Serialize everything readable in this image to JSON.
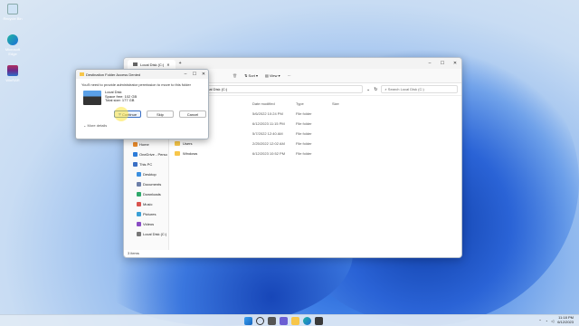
{
  "desktop": {
    "icons": [
      {
        "name": "recycle-bin-icon",
        "label": "Recycle Bin"
      },
      {
        "name": "edge-icon",
        "label": "Microsoft Edge"
      },
      {
        "name": "winrar-icon",
        "label": "WinRAR"
      }
    ]
  },
  "explorer": {
    "tab_title": "Local Disk (C:)",
    "toolbar": {
      "sort_label": "Sort",
      "view_label": "View",
      "more": "···"
    },
    "address": "Local Disk (C:)",
    "search_placeholder": "Search Local Disk (C:)",
    "columns": {
      "name": "Name",
      "date": "Date modified",
      "type": "Type",
      "size": "Size"
    },
    "rows": [
      {
        "name": "",
        "date": "5/6/2022 10:24 PM",
        "type": "File folder"
      },
      {
        "name": "",
        "date": "6/12/2023 11:15 PM",
        "type": "File folder"
      },
      {
        "name": "",
        "date": "5/7/2022 12:40 AM",
        "type": "File folder"
      },
      {
        "name": "Users",
        "date": "2/25/2022 12:02 AM",
        "type": "File folder"
      },
      {
        "name": "Windows",
        "date": "6/12/2023 10:52 PM",
        "type": "File folder"
      }
    ],
    "nav": [
      {
        "label": "Home"
      },
      {
        "label": "OneDrive - Perso"
      },
      {
        "label": "This PC"
      },
      {
        "label": "Desktop"
      },
      {
        "label": "Documents"
      },
      {
        "label": "Downloads"
      },
      {
        "label": "Music"
      },
      {
        "label": "Pictures"
      },
      {
        "label": "Videos"
      },
      {
        "label": "Local Disk (C:)"
      }
    ],
    "status": "3 items"
  },
  "dialog": {
    "title": "Destination Folder Access Denied",
    "message": "You'll need to provide administrator permission to move to this folder",
    "drive_name": "Local Disk",
    "space_free": "Space free: 102 GB",
    "total_size": "Total size: 177 GB",
    "continue_label": "Continue",
    "skip_label": "Skip",
    "cancel_label": "Cancel",
    "more_details": "More details"
  },
  "taskbar": {
    "time": "11:18 PM",
    "date": "6/12/2023"
  },
  "colors": {
    "accent": "#3a6fc4",
    "folder": "#f7c64a"
  }
}
